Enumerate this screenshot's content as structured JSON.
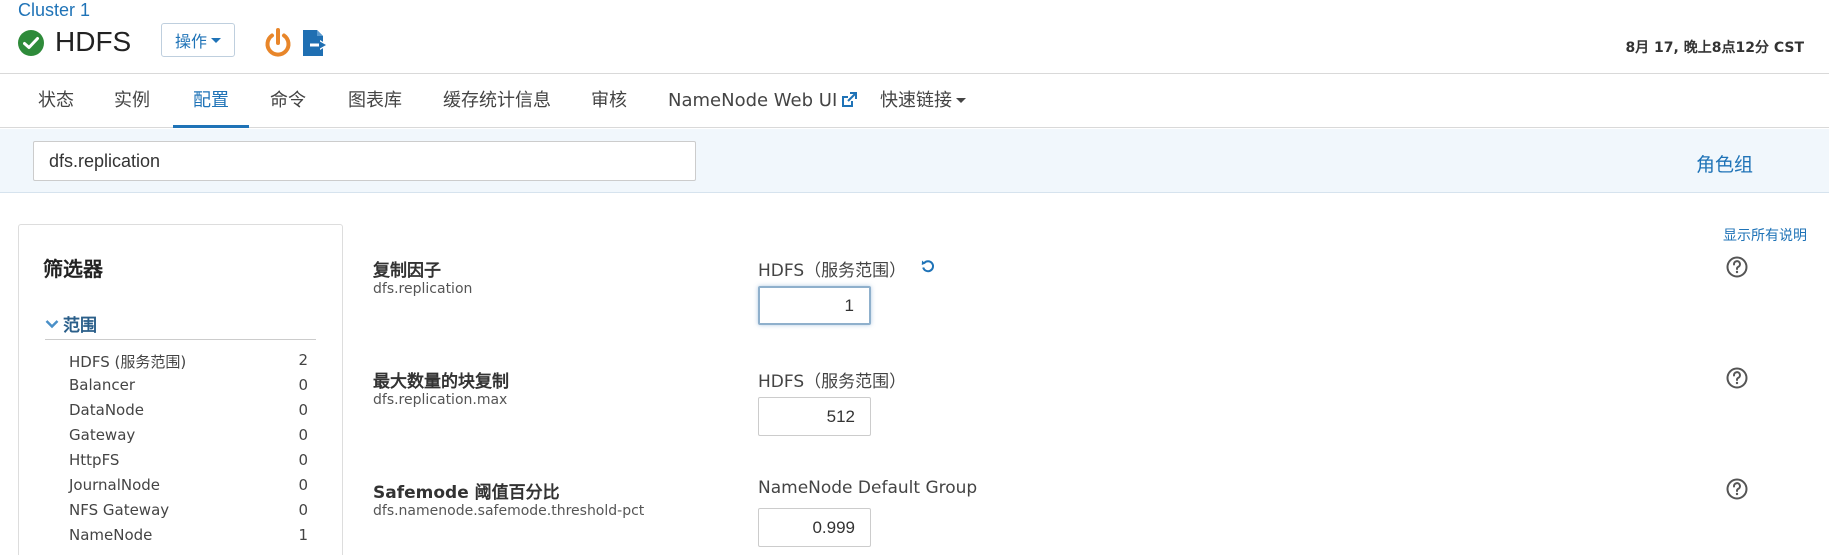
{
  "header": {
    "cluster_name": "Cluster 1",
    "service_name": "HDFS",
    "actions_label": "操作",
    "timestamp": "8月 17, 晚上8点12分 CST"
  },
  "tabs": [
    {
      "label": "状态"
    },
    {
      "label": "实例"
    },
    {
      "label": "配置"
    },
    {
      "label": "命令"
    },
    {
      "label": "图表库"
    },
    {
      "label": "缓存统计信息"
    },
    {
      "label": "审核"
    },
    {
      "label": "NameNode Web UI"
    },
    {
      "label": "快速链接"
    }
  ],
  "search": {
    "value": "dfs.replication"
  },
  "role_groups_label": "角色组",
  "show_all_descriptions_label": "显示所有说明",
  "filter": {
    "title": "筛选器",
    "scope_label": "范围",
    "items": [
      {
        "label": "HDFS (服务范围)",
        "count": "2"
      },
      {
        "label": "Balancer",
        "count": "0"
      },
      {
        "label": "DataNode",
        "count": "0"
      },
      {
        "label": "Gateway",
        "count": "0"
      },
      {
        "label": "HttpFS",
        "count": "0"
      },
      {
        "label": "JournalNode",
        "count": "0"
      },
      {
        "label": "NFS Gateway",
        "count": "0"
      },
      {
        "label": "NameNode",
        "count": "1"
      }
    ]
  },
  "properties": [
    {
      "name": "复制因子",
      "key": "dfs.replication",
      "scope": "HDFS（服务范围）",
      "value": "1"
    },
    {
      "name": "最大数量的块复制",
      "key": "dfs.replication.max",
      "scope": "HDFS（服务范围）",
      "value": "512"
    },
    {
      "name": "Safemode 阈值百分比",
      "key": "dfs.namenode.safemode.threshold-pct",
      "scope": "NameNode Default Group",
      "value": "0.999"
    }
  ],
  "colors": {
    "accent": "#1f73b7",
    "status_ok": "#2e8b3a",
    "power_icon": "#e8862a",
    "search_bar_bg": "#f1f7fc"
  },
  "icons": {
    "status": "check-circle-icon",
    "power": "power-icon",
    "redeploy": "redeploy-config-icon",
    "external": "external-link-icon",
    "reset": "undo-icon",
    "help": "question-circle-icon",
    "collapse": "chevron-down-icon"
  }
}
